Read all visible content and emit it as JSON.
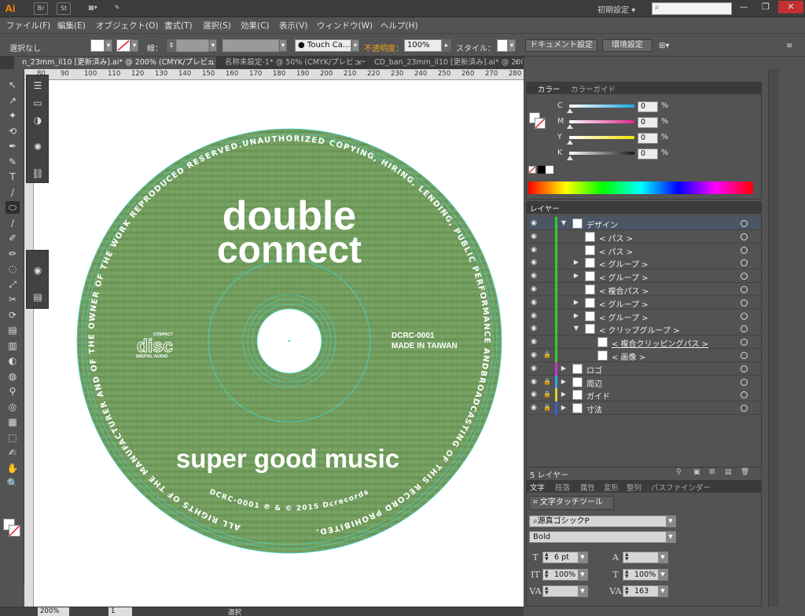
{
  "app": {
    "logo": "Ai",
    "workspace": "初期設定",
    "workspace_arrow": "▾",
    "window_buttons": [
      "—",
      "❐",
      "✕"
    ],
    "title_icons": [
      "Br",
      "St",
      "▦▾",
      "✎"
    ]
  },
  "menu": [
    "ファイル(F)",
    "編集(E)",
    "オブジェクト(O)",
    "書式(T)",
    "選択(S)",
    "効果(C)",
    "表示(V)",
    "ウィンドウ(W)",
    "ヘルプ(H)"
  ],
  "control": {
    "selection": "選択なし",
    "stroke_label": "線：",
    "opacity_label": "不透明度：",
    "opacity_value": "100%",
    "style_label": "スタイル：",
    "brush_value": "Touch Ca...",
    "doc_setup": "ドキュメント設定",
    "preferences": "環境設定",
    "arrange_icon": "⊞▾",
    "menu_icon": "≡",
    "opacity_color": "#f0a020"
  },
  "tabs": [
    {
      "label": "n_23mm_il10 [更新済み].ai* @ 200% (CMYK/プレビュー)",
      "close": "×"
    },
    {
      "label": "名称未設定-1* @ 50% (CMYK/プレビュー)",
      "close": "×"
    },
    {
      "label": "CD_ban_23mm_il10 [更新済み].ai* @ 200% (CMYK/プレビュー)",
      "close": "×"
    }
  ],
  "ruler": [
    "80",
    "90",
    "100",
    "110",
    "120",
    "130",
    "140",
    "150",
    "160",
    "170",
    "180",
    "190",
    "200",
    "210",
    "220",
    "230",
    "240",
    "250",
    "260",
    "270",
    "280"
  ],
  "disc": {
    "title_line1": "double",
    "title_line2": "connect",
    "tagline": "super good music",
    "catalog": "DCRC-0001",
    "made_in": "MADE IN TAIWAN",
    "compact_top": "COMPACT",
    "compact_logo": "disc",
    "compact_bottom": "DIGITAL AUDIO",
    "rim_text": "ALL RIGHTS OF THE MANUFACTURER AND OF THE OWNER OF THE WORK REPRODUCED RESERVED.UNAUTHORIZED COPYING, HIRING, LENDING, PUBLIC PERFORMANCE ANDBROADCASTING OF THIS RECORD PROHIBITED.",
    "rim_bottom": "DCRC-0001 ℗ & © 2015 Dcrecords",
    "colors": {
      "base": "#6f9a5c",
      "dark": "#4f7a43",
      "guide": "#3fd9d4"
    }
  },
  "tools": [
    "↖",
    "↗",
    "✦",
    "⟲",
    "✒",
    "✎",
    "T",
    "/",
    "⬭",
    "∕",
    "✐",
    "✏",
    "◌",
    "⤢",
    "✂",
    "⟳",
    "▤",
    "▥",
    "◐",
    "◍",
    "⚲",
    "◎",
    "▦",
    "⬚",
    "✍",
    "✋",
    "🔍"
  ],
  "color_panel": {
    "tabs": [
      "カラー",
      "カラーガイド"
    ],
    "sliders": [
      {
        "label": "C",
        "value": "0",
        "pct": "%",
        "color": "#1fa8e0"
      },
      {
        "label": "M",
        "value": "0",
        "pct": "%",
        "color": "#e0258f"
      },
      {
        "label": "Y",
        "value": "0",
        "pct": "%",
        "color": "#f2e200"
      },
      {
        "label": "K",
        "value": "0",
        "pct": "%",
        "color": "#1a1a1a"
      }
    ]
  },
  "layers_panel": {
    "tab": "レイヤー",
    "count": "5 レイヤー",
    "layers": [
      {
        "name": "デザイン",
        "indent": 0,
        "tri": "▼",
        "bar": "#33cc33",
        "lock": "",
        "sel": true
      },
      {
        "name": "< パス >",
        "indent": 1,
        "tri": "",
        "bar": "#33cc33",
        "lock": ""
      },
      {
        "name": "< パス >",
        "indent": 1,
        "tri": "",
        "bar": "#33cc33",
        "lock": ""
      },
      {
        "name": "< グループ >",
        "indent": 1,
        "tri": "▶",
        "bar": "#33cc33",
        "lock": ""
      },
      {
        "name": "< グループ >",
        "indent": 1,
        "tri": "▶",
        "bar": "#33cc33",
        "lock": ""
      },
      {
        "name": "< 複合パス >",
        "indent": 1,
        "tri": "",
        "bar": "#33cc33",
        "lock": ""
      },
      {
        "name": "< グループ >",
        "indent": 1,
        "tri": "▶",
        "bar": "#33cc33",
        "lock": ""
      },
      {
        "name": "< グループ >",
        "indent": 1,
        "tri": "▶",
        "bar": "#33cc33",
        "lock": ""
      },
      {
        "name": "< クリップグループ >",
        "indent": 1,
        "tri": "▼",
        "bar": "#33cc33",
        "lock": ""
      },
      {
        "name": "< 複合クリッピングパス >",
        "indent": 2,
        "tri": "",
        "bar": "#33cc33",
        "lock": "",
        "underline": true
      },
      {
        "name": "< 画像 >",
        "indent": 2,
        "tri": "",
        "bar": "#33cc33",
        "lock": "🔒"
      },
      {
        "name": "ロゴ",
        "indent": 0,
        "tri": "▶",
        "bar": "#d030d0",
        "lock": ""
      },
      {
        "name": "周辺",
        "indent": 0,
        "tri": "▶",
        "bar": "#30a8e0",
        "lock": "🔒"
      },
      {
        "name": "ガイド",
        "indent": 0,
        "tri": "▶",
        "bar": "#e0d030",
        "lock": "🔒"
      },
      {
        "name": "寸法",
        "indent": 0,
        "tri": "▶",
        "bar": "#3060e0",
        "lock": "🔒"
      }
    ]
  },
  "type_panel": {
    "tabs": [
      "文字",
      "段落",
      "属性",
      "変形",
      "整列",
      "パスファインダー"
    ],
    "touch_button": "文字タッチツール",
    "font_family": "源真ゴシックP",
    "font_style": "Bold",
    "font_size": "6 pt",
    "leading": "",
    "vscale": "100%",
    "hscale": "100%",
    "kerning": "",
    "tracking": "163"
  },
  "status": {
    "zoom": "200%",
    "page": "1",
    "mode": "選択"
  }
}
